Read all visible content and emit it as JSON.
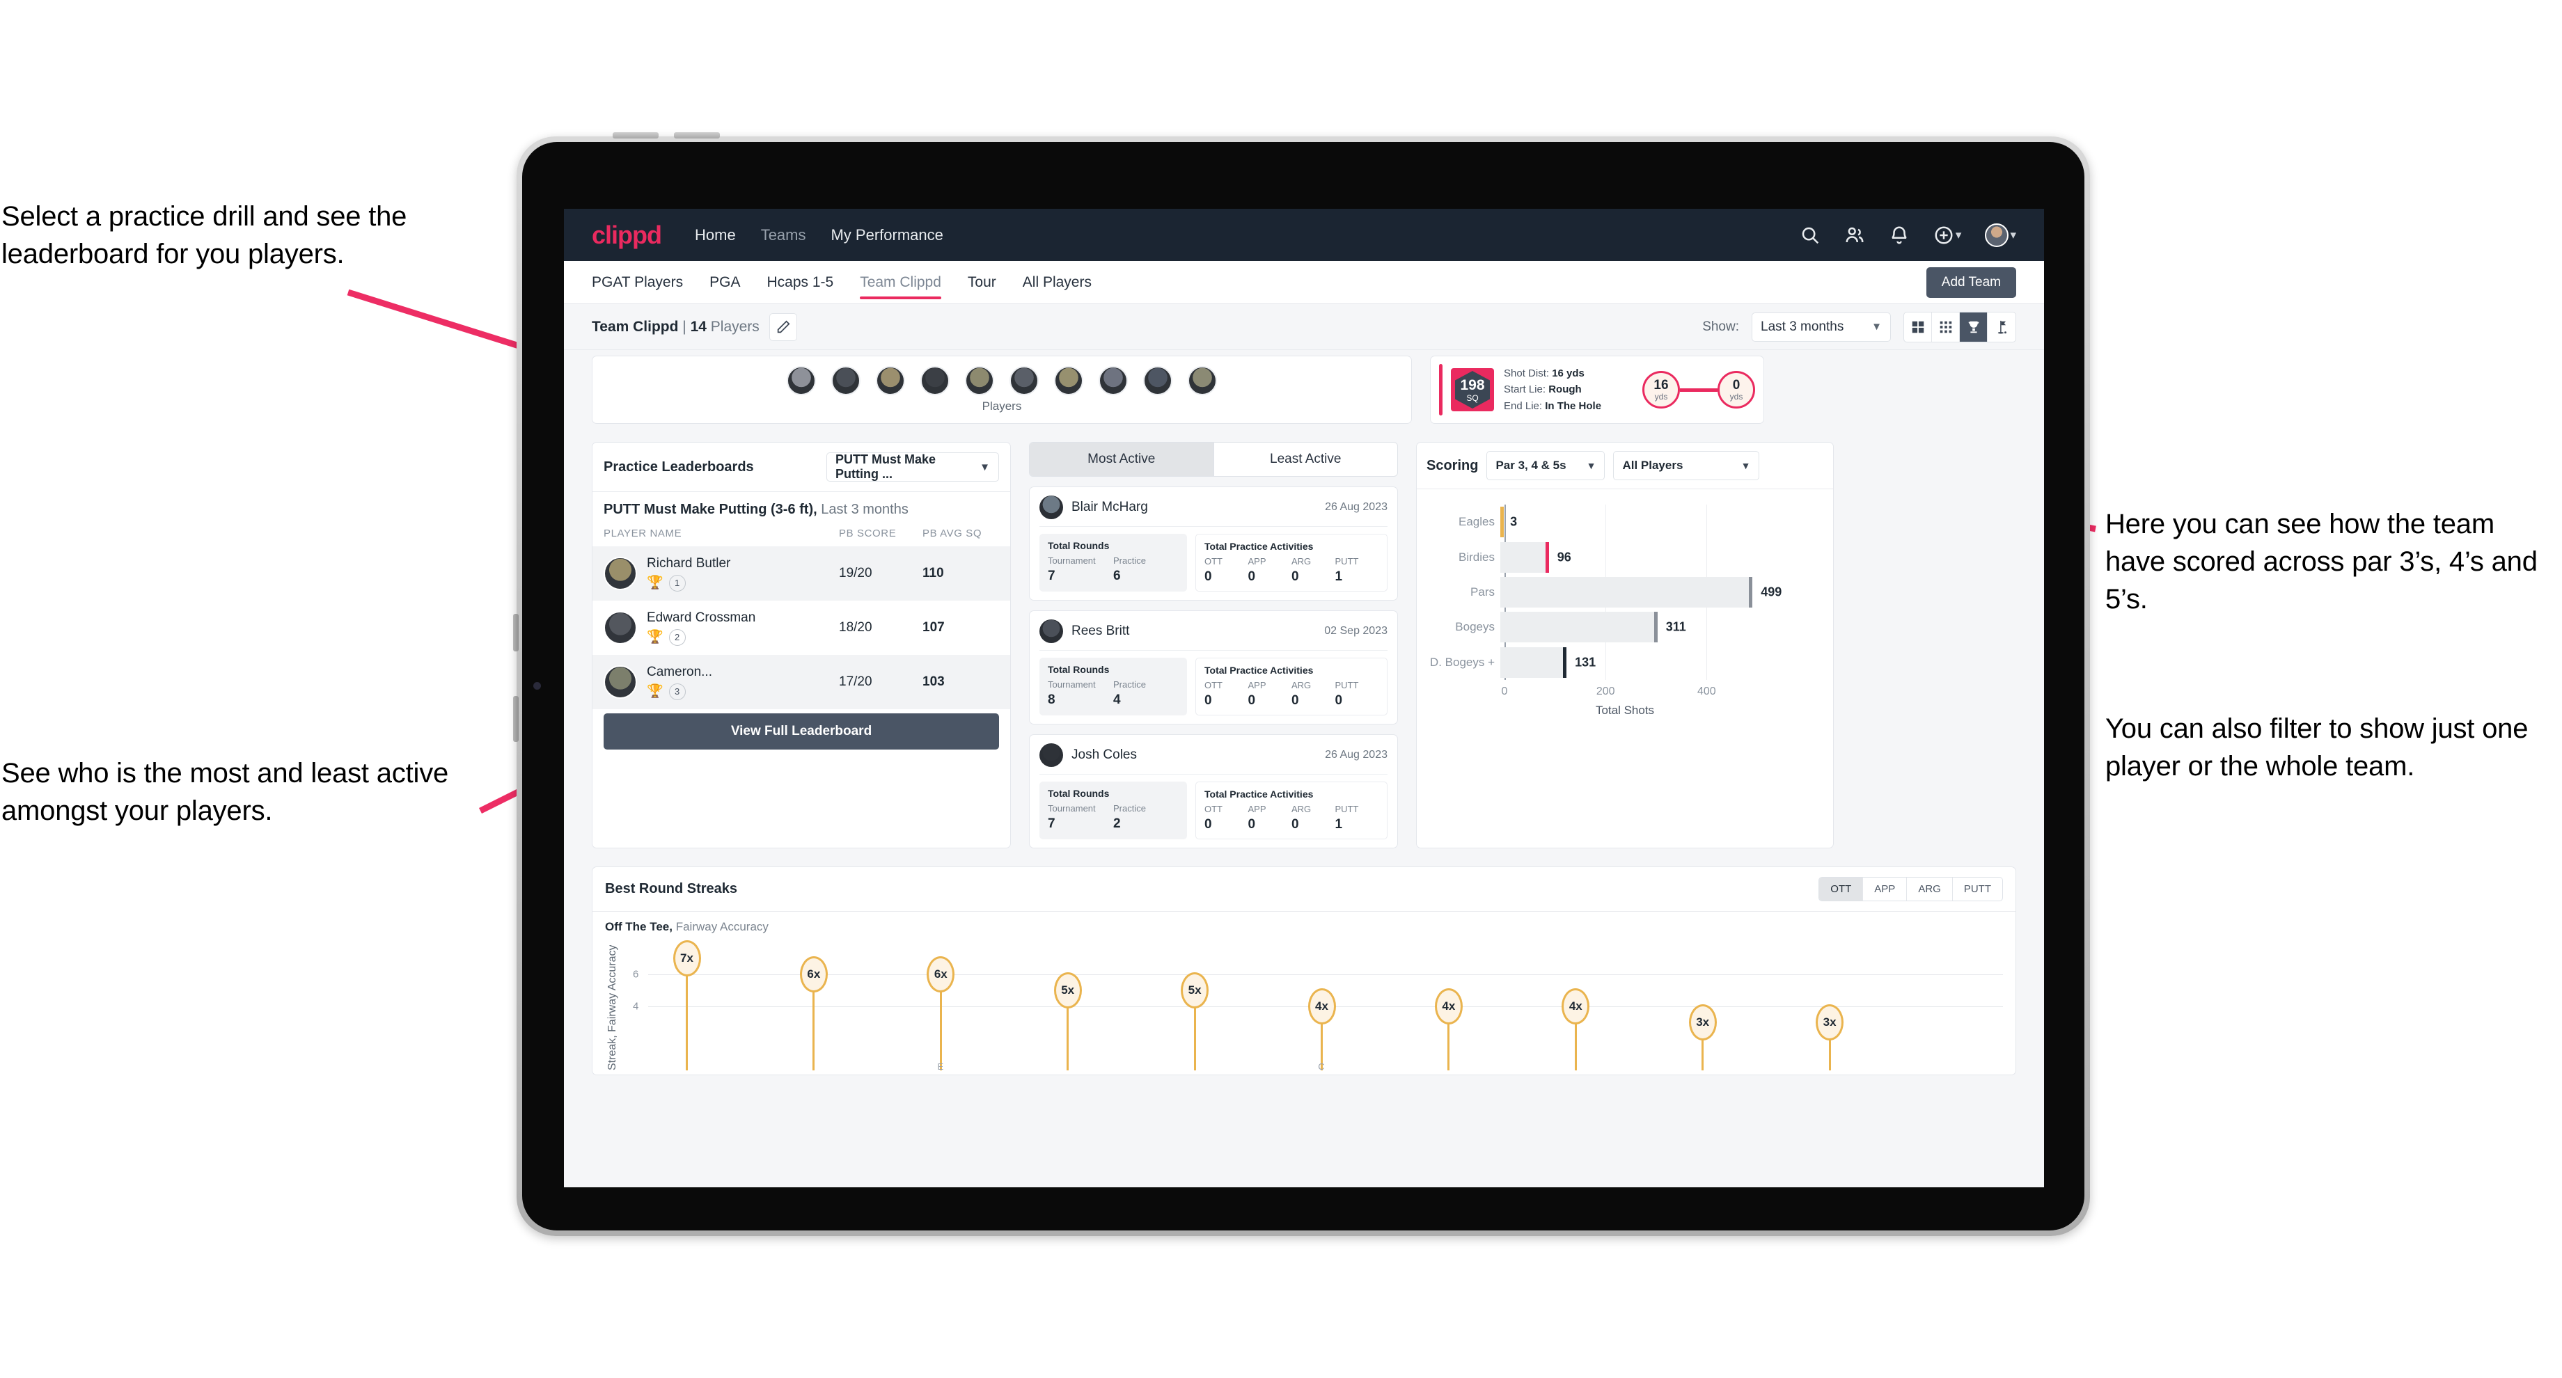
{
  "annotations": {
    "practice": "Select a practice drill and see the leaderboard for you players.",
    "active": "See who is the most and least active amongst your players.",
    "scoring": "Here you can see how the team have scored across par 3’s, 4’s and 5’s.",
    "filter": "You can also filter to show just one player or the whole team.",
    "accent_color": "#ed2d64"
  },
  "app": {
    "logo": "clippd",
    "nav": [
      {
        "label": "Home",
        "active": true
      },
      {
        "label": "Teams",
        "active": false
      },
      {
        "label": "My Performance",
        "active": true
      }
    ],
    "header_icons": [
      "search-icon",
      "people-icon",
      "bell-icon",
      "plus-circle-icon",
      "avatar"
    ]
  },
  "tabs": [
    {
      "label": "PGAT Players",
      "active": false
    },
    {
      "label": "PGA",
      "active": false
    },
    {
      "label": "Hcaps 1-5",
      "active": false
    },
    {
      "label": "Team Clippd",
      "active": true
    },
    {
      "label": "Tour",
      "active": false
    },
    {
      "label": "All Players",
      "active": false
    }
  ],
  "add_team_button": "Add Team",
  "subbar": {
    "team_name": "Team Clippd",
    "separator": " | ",
    "player_count": "14",
    "players_word": " Players",
    "edit_icon": "pencil-icon",
    "show_label": "Show:",
    "show_value": "Last 3 months",
    "view_buttons": [
      {
        "name": "grid-view-icon",
        "active": false
      },
      {
        "name": "dense-grid-view-icon",
        "active": false
      },
      {
        "name": "trophy-view-icon",
        "active": true
      },
      {
        "name": "flag-view-icon",
        "active": false
      }
    ]
  },
  "players_strip": {
    "caption": "Players",
    "avatar_count": 10
  },
  "shot_card": {
    "sq_value": "198",
    "sq_label": "SQ",
    "shot_dist_label": "Shot Dist:",
    "shot_dist_value": "16 yds",
    "start_lie_label": "Start Lie:",
    "start_lie_value": "Rough",
    "end_lie_label": "End Lie:",
    "end_lie_value": "In The Hole",
    "start_circle": {
      "value": "16",
      "unit": "yds"
    },
    "end_circle": {
      "value": "0",
      "unit": "yds"
    }
  },
  "practice_leaderboard": {
    "title": "Practice Leaderboards",
    "drill_select": "PUTT Must Make Putting ...",
    "subtitle_bold": "PUTT Must Make Putting (3-6 ft),",
    "subtitle_light": " Last 3 months",
    "columns": [
      "PLAYER NAME",
      "PB SCORE",
      "PB AVG SQ"
    ],
    "rows": [
      {
        "name": "Richard Butler",
        "rank": "1",
        "trophy": "gold",
        "pb_score": "19/20",
        "pb_avg_sq": "110"
      },
      {
        "name": "Edward Crossman",
        "rank": "2",
        "trophy": "silver",
        "pb_score": "18/20",
        "pb_avg_sq": "107"
      },
      {
        "name": "Cameron...",
        "rank": "3",
        "trophy": "bronze",
        "pb_score": "17/20",
        "pb_avg_sq": "103"
      }
    ],
    "button": "View Full Leaderboard"
  },
  "activity": {
    "tabs": [
      {
        "label": "Most Active",
        "active": true
      },
      {
        "label": "Least Active",
        "active": false
      }
    ],
    "rounds_title": "Total Rounds",
    "rounds_cols": [
      "Tournament",
      "Practice"
    ],
    "acts_title": "Total Practice Activities",
    "acts_cols": [
      "OTT",
      "APP",
      "ARG",
      "PUTT"
    ],
    "players": [
      {
        "name": "Blair McHarg",
        "date": "26 Aug 2023",
        "tournament": "7",
        "practice": "6",
        "ott": "0",
        "app": "0",
        "arg": "0",
        "putt": "1"
      },
      {
        "name": "Rees Britt",
        "date": "02 Sep 2023",
        "tournament": "8",
        "practice": "4",
        "ott": "0",
        "app": "0",
        "arg": "0",
        "putt": "0"
      },
      {
        "name": "Josh Coles",
        "date": "26 Aug 2023",
        "tournament": "7",
        "practice": "2",
        "ott": "0",
        "app": "0",
        "arg": "0",
        "putt": "1"
      }
    ]
  },
  "scoring": {
    "title": "Scoring",
    "par_select": "Par 3, 4 & 5s",
    "player_select": "All Players"
  },
  "streaks": {
    "title": "Best Round Streaks",
    "toggle": [
      {
        "label": "OTT",
        "active": true
      },
      {
        "label": "APP",
        "active": false
      },
      {
        "label": "ARG",
        "active": false
      },
      {
        "label": "PUTT",
        "active": false
      }
    ],
    "sub_bold": "Off The Tee,",
    "sub_light": " Fairway Accuracy"
  },
  "chart_data": [
    {
      "type": "bar",
      "orientation": "horizontal",
      "title": "Scoring",
      "categories": [
        "Eagles",
        "Birdies",
        "Pars",
        "Bogeys",
        "D. Bogeys +"
      ],
      "values": [
        3,
        96,
        499,
        311,
        131
      ],
      "cap_colors": [
        "#eab44e",
        "#ea2a5f",
        "#8a9099",
        "#8a9099",
        "#1f2933"
      ],
      "xlabel": "Total Shots",
      "ylabel": "",
      "xlim": [
        0,
        540
      ],
      "xticks": [
        0,
        200,
        400
      ],
      "grid": true,
      "legend": "none"
    },
    {
      "type": "scatter",
      "variant": "lollipop",
      "title": "Best Round Streaks",
      "subtitle": "Off The Tee, Fairway Accuracy",
      "ylabel": "Streak, Fairway Accuracy",
      "xlabel": "",
      "ylim": [
        0,
        8
      ],
      "yticks": [
        4,
        6
      ],
      "grid": true,
      "labels": [
        "7x",
        "6x",
        "6x",
        "5x",
        "5x",
        "4x",
        "4x",
        "4x",
        "3x",
        "3x"
      ],
      "values": [
        7,
        6,
        6,
        5,
        5,
        4,
        4,
        4,
        3,
        3
      ],
      "x_tick_labels": [
        "",
        "",
        "E",
        "",
        "",
        "C",
        "",
        "",
        "",
        ""
      ],
      "marker_color": "#eab44e",
      "marker_fill": "#fdf3e4"
    }
  ]
}
